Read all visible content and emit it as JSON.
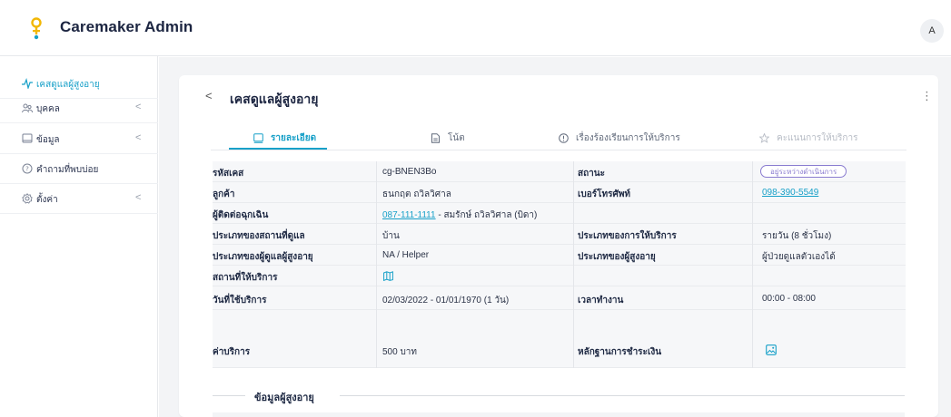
{
  "app": {
    "brand": "Caremaker Admin",
    "avatar_initial": "A"
  },
  "sidebar": {
    "items": [
      {
        "label": "เคสดูแลผู้สูงอายุ",
        "icon": "pulse-icon",
        "active": true
      },
      {
        "label": "บุคคล",
        "icon": "people-icon",
        "has_children": true
      },
      {
        "label": "ข้อมูล",
        "icon": "square-icon",
        "has_children": true
      },
      {
        "label": "คำถามที่พบบ่อย",
        "icon": "question-circle-icon"
      },
      {
        "label": "ตั้งค่า",
        "icon": "gear-icon",
        "has_children": true
      }
    ],
    "chevron": "<"
  },
  "card": {
    "back": "<",
    "title": "เคสดูแลผู้สูงอายุ",
    "more": "⋮"
  },
  "tabs": [
    {
      "label": "รายละเอียด",
      "icon": "monitor-icon",
      "state": "active"
    },
    {
      "label": "โน้ต",
      "icon": "note-icon",
      "state": "normal"
    },
    {
      "label": "เรื่องร้องเรียนการให้บริการ",
      "icon": "info-circle-icon",
      "state": "normal"
    },
    {
      "label": "คะแนนการให้บริการ",
      "icon": "star-icon",
      "state": "disabled"
    }
  ],
  "details": {
    "case_id_label": "รหัสเคส",
    "case_id": "cg-BNEN3Bo",
    "status_label": "สถานะ",
    "status": "อยู่ระหว่างดำเนินการ",
    "customer_label": "ลูกค้า",
    "customer": "ธนกฤต ถวิลวิศาล",
    "phone_label": "เบอร์โทรศัพท์",
    "phone": "098-390-5549",
    "emergency_label": "ผู้ติดต่อฉุกเฉิน",
    "emergency_phone": "087-111-1111",
    "emergency_name": " - สมรักษ์ ถวิลวิศาล (บิดา)",
    "place_type_label": "ประเภทของสถานที่ดูแล",
    "place_type": "บ้าน",
    "service_type_label": "ประเภทของการให้บริการ",
    "service_type": "รายวัน (8 ชั่วโมง)",
    "caregiver_type_label": "ประเภทของผู้ดูแลผู้สูงอายุ",
    "caregiver_type": "NA / Helper",
    "elder_type_label": "ประเภทของผู้สูงอายุ",
    "elder_type": "ผู้ป่วยดูแลตัวเองได้",
    "location_label": "สถานที่ให้บริการ",
    "location_icon": "map-icon",
    "service_date_label": "วันที่ใช้บริการ",
    "service_date": "02/03/2022 - 01/01/1970 (1 วัน)",
    "work_time_label": "เวลาทำงาน",
    "work_time": "00:00 - 08:00",
    "fee_label": "ค่าบริการ",
    "fee": "500 บาท",
    "payment_proof_label": "หลักฐานการชำระเงิน",
    "payment_proof_icon": "image-icon"
  },
  "section": {
    "title": "ข้อมูลผู้สูงอายุ"
  },
  "colors": {
    "accent": "#17a0c8",
    "badge": "#8a7cd0",
    "logo_yellow": "#f2b705",
    "logo_cyan": "#17a0c8"
  }
}
